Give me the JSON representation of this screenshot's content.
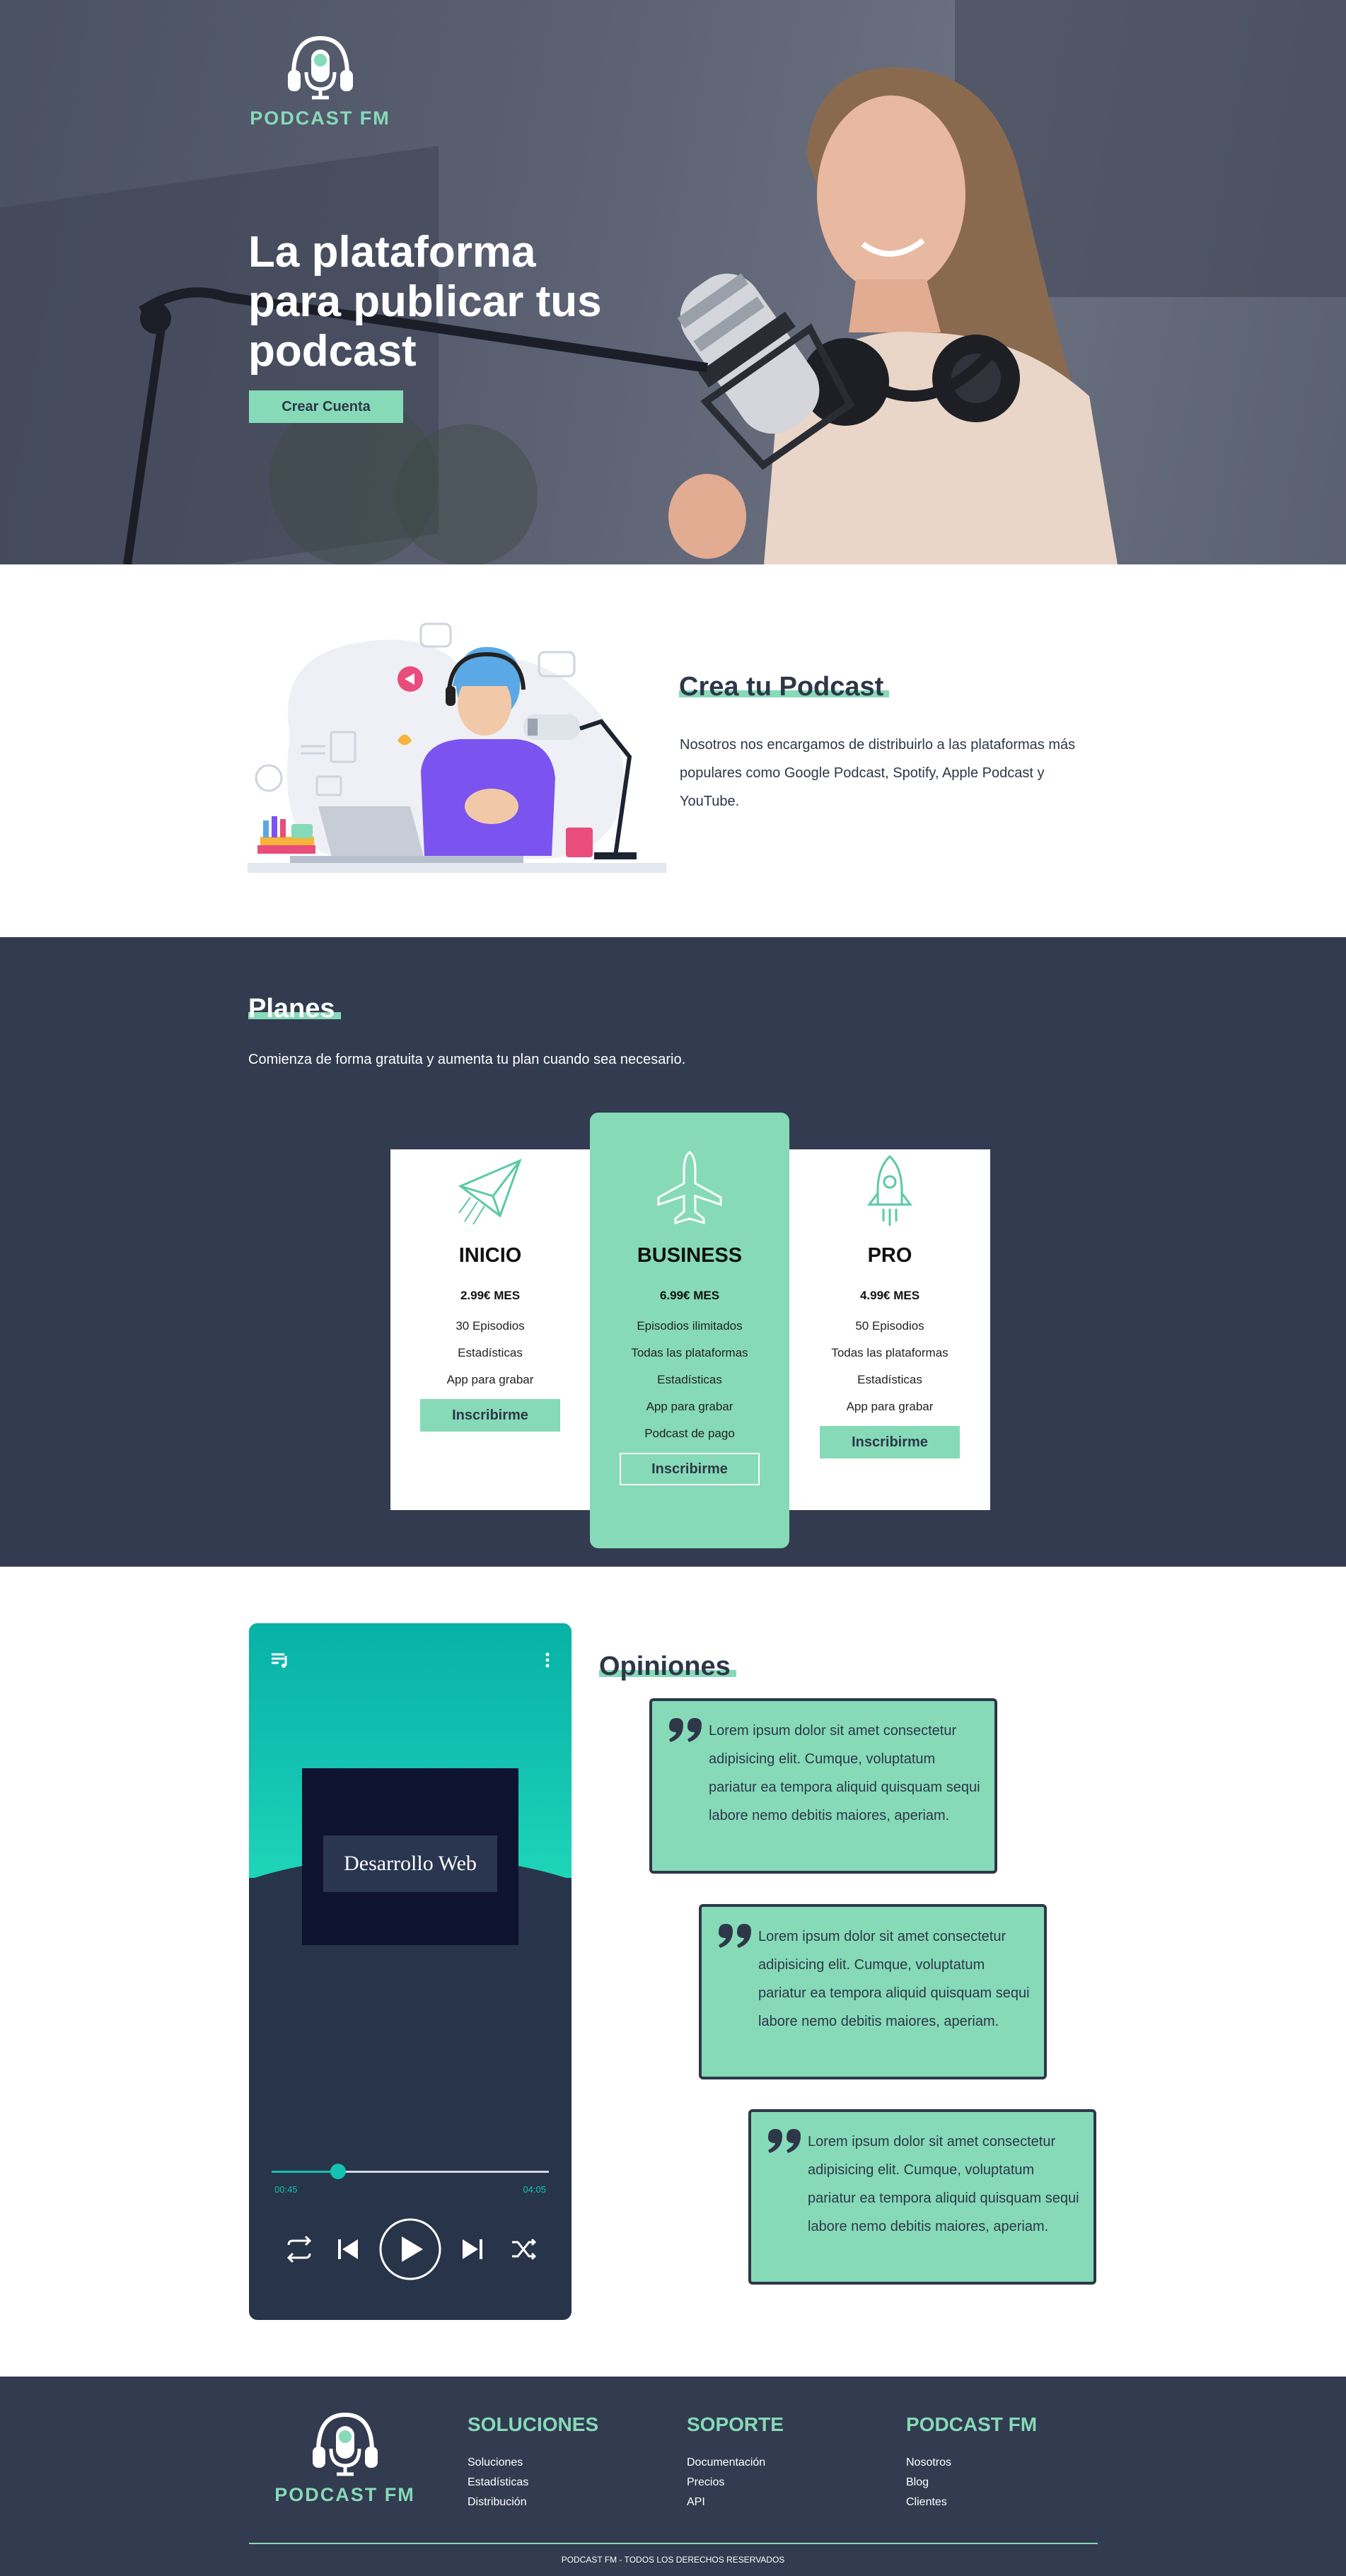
{
  "brand": {
    "name": "PODCAST FM",
    "accent": "#86dab8",
    "dark": "#323b4f"
  },
  "hero": {
    "title": "La plataforma para publicar tus podcast",
    "cta": "Crear Cuenta",
    "logo_icon": "headphones-microphone-icon"
  },
  "crea": {
    "title": "Crea tu Podcast",
    "text": "Nosotros nos encargamos de distribuirlo a las plataformas más populares como Google Podcast, Spotify, Apple Podcast y YouTube."
  },
  "planes": {
    "title": "Planes",
    "description": "Comienza de forma gratuita y aumenta tu plan cuando sea necesario.",
    "plans": [
      {
        "icon": "paper-plane-icon",
        "name": "INICIO",
        "price": "2.99€ MES",
        "features": [
          "30 Episodios",
          "Estadísticas",
          "App para grabar"
        ],
        "button": "Inscribirme"
      },
      {
        "icon": "airplane-icon",
        "name": "BUSINESS",
        "price": "6.99€ MES",
        "features": [
          "Episodios ilimitados",
          "Todas las plataformas",
          "Estadísticas",
          "App para grabar",
          "Podcast de pago"
        ],
        "button": "Inscribirme"
      },
      {
        "icon": "rocket-icon",
        "name": "PRO",
        "price": "4.99€ MES",
        "features": [
          "50 Episodios",
          "Todas las plataformas",
          "Estadísticas",
          "App para grabar"
        ],
        "button": "Inscribirme"
      }
    ]
  },
  "player": {
    "album_title": "Desarrollo Web",
    "current_time": "00:45",
    "total_time": "04:05",
    "progress": 0.24,
    "controls": [
      "repeat-icon",
      "previous-icon",
      "play-icon",
      "next-icon",
      "shuffle-icon"
    ]
  },
  "opiniones": {
    "title": "Opiniones",
    "quotes": [
      "Lorem ipsum dolor sit amet consectetur adipisicing elit. Cumque, voluptatum pariatur ea tempora aliquid quisquam sequi labore nemo debitis maiores, aperiam.",
      "Lorem ipsum dolor sit amet consectetur adipisicing elit. Cumque, voluptatum pariatur ea tempora aliquid quisquam sequi labore nemo debitis maiores, aperiam.",
      "Lorem ipsum dolor sit amet consectetur adipisicing elit. Cumque, voluptatum pariatur ea tempora aliquid quisquam sequi labore nemo debitis maiores, aperiam."
    ]
  },
  "footer": {
    "columns": [
      {
        "title": "SOLUCIONES",
        "links": [
          "Soluciones",
          "Estadísticas",
          "Distribución"
        ]
      },
      {
        "title": "SOPORTE",
        "links": [
          "Documentación",
          "Precios",
          "API"
        ]
      },
      {
        "title": "PODCAST FM",
        "links": [
          "Nosotros",
          "Blog",
          "Clientes"
        ]
      }
    ],
    "copyright": "PODCAST FM - TODOS LOS DERECHOS RESERVADOS"
  }
}
